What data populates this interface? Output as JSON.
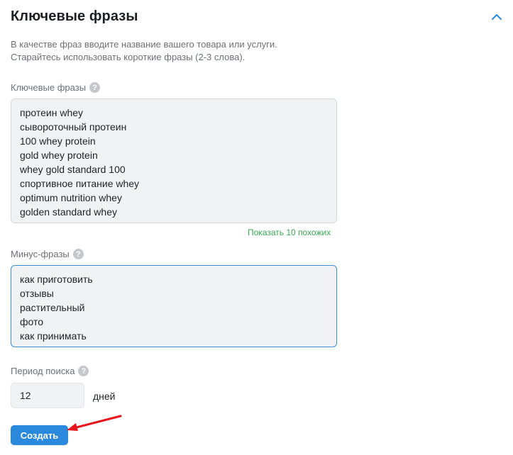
{
  "section": {
    "title": "Ключевые фразы",
    "description_line1": "В качестве фраз вводите название вашего товара или услуги.",
    "description_line2": "Старайтесь использовать короткие фразы (2-3 слова)."
  },
  "keywords": {
    "label": "Ключевые фразы",
    "help": "?",
    "lines": [
      "протеин whey",
      "сывороточный протеин",
      "100 whey protein",
      "gold whey protein",
      "whey gold standard 100",
      "спортивное питание whey",
      "optimum nutrition whey",
      "golden standard whey"
    ],
    "similar_link": "Показать 10 похожих"
  },
  "minus": {
    "label": "Минус-фразы",
    "help": "?",
    "lines": [
      "как приготовить",
      "отзывы",
      "растительный",
      "фото",
      "как принимать"
    ]
  },
  "period": {
    "label": "Период поиска",
    "help": "?",
    "value": "12",
    "unit": "дней"
  },
  "actions": {
    "create_label": "Создать"
  },
  "colors": {
    "accent": "#2a88dd",
    "link_green": "#3aa854",
    "annotation_arrow": "#e8141b"
  },
  "icons": {
    "collapse": "chevron-up-icon",
    "help": "question-circle-icon",
    "annotation": "red-arrow-icon"
  }
}
